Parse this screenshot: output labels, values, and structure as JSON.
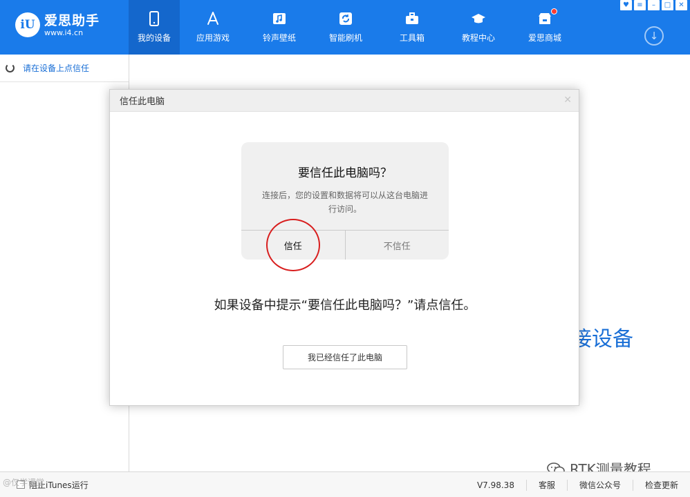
{
  "app": {
    "logo_mark": "iU",
    "name": "爱思助手",
    "url": "www.i4.cn"
  },
  "nav": [
    {
      "label": "我的设备",
      "icon": "phone-icon"
    },
    {
      "label": "应用游戏",
      "icon": "app-store-icon"
    },
    {
      "label": "铃声壁纸",
      "icon": "music-icon"
    },
    {
      "label": "智能刷机",
      "icon": "refresh-icon"
    },
    {
      "label": "工具箱",
      "icon": "toolbox-icon"
    },
    {
      "label": "教程中心",
      "icon": "graduation-cap-icon"
    },
    {
      "label": "爱思商城",
      "icon": "shop-icon"
    }
  ],
  "sidebar": {
    "items": [
      {
        "label": "请在设备上点信任"
      }
    ]
  },
  "background_text": "接设备",
  "dialog": {
    "title": "信任此电脑",
    "ios_title": "要信任此电脑吗？",
    "ios_message": "连接后，您的设置和数据将可以从这台电脑进行访问。",
    "trust_label": "信任",
    "distrust_label": "不信任",
    "instruction": "如果设备中提示“要信任此电脑吗？”请点信任。",
    "confirm_label": "我已经信任了此电脑"
  },
  "watermark": "RTK测量教程",
  "footer": {
    "corner_watermark": "@仅学课堂",
    "block_itunes": "阻止iTunes运行",
    "version": "V7.98.38",
    "service": "客服",
    "wechat": "微信公众号",
    "update": "检查更新"
  },
  "colors": {
    "header_bg": "#1a7bea",
    "accent": "#1a6fd6",
    "highlight_circle": "#d81e1e"
  }
}
